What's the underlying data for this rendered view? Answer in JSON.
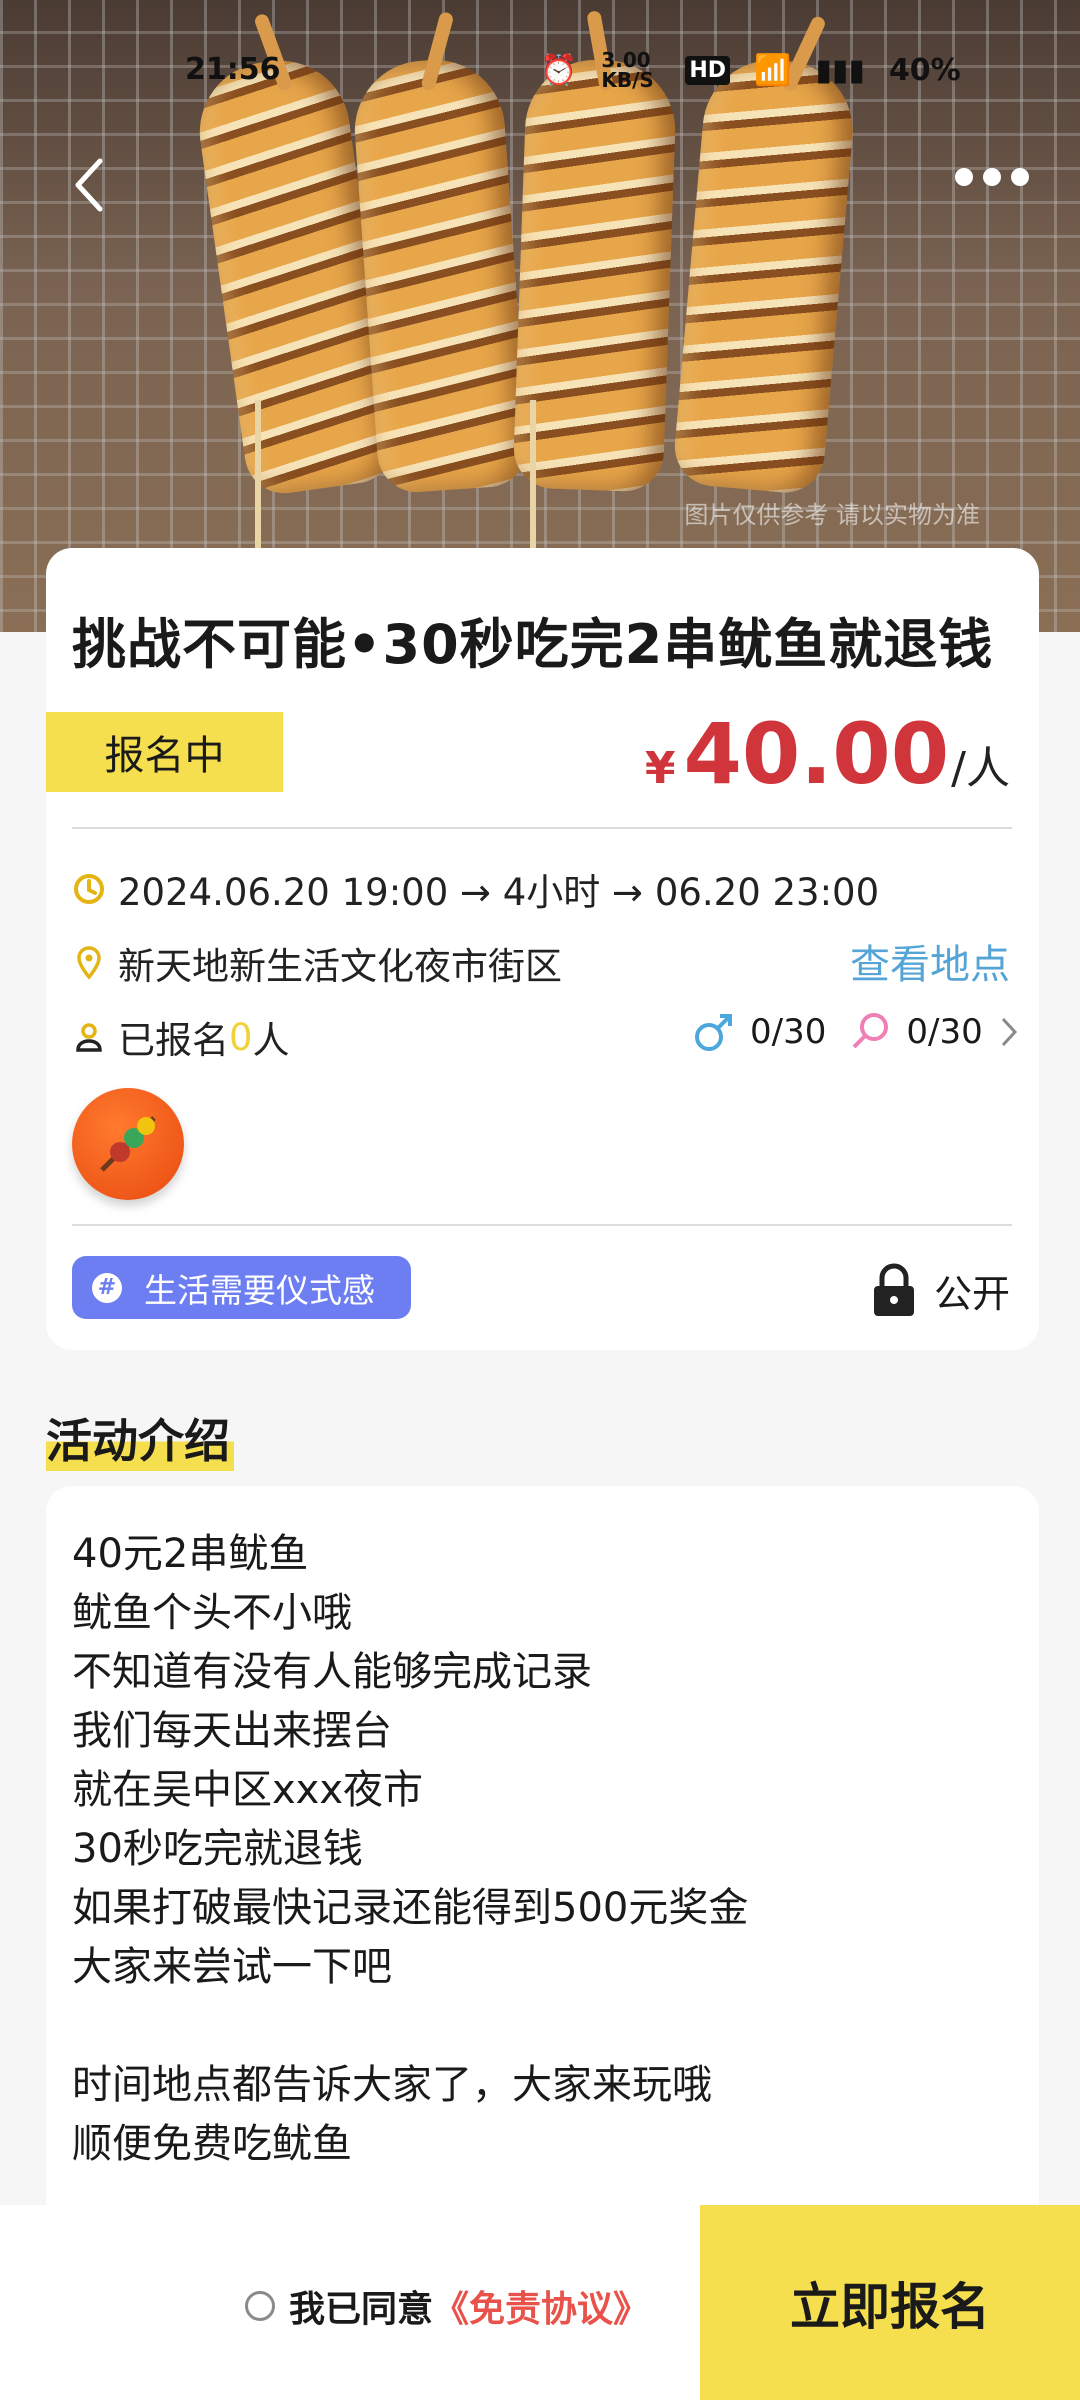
{
  "status_bar": {
    "time": "21:56",
    "speed": "3.00 KB/S",
    "battery": "40%"
  },
  "hero": {
    "watermark": "图片仅供参考 请以实物为准"
  },
  "event": {
    "title": "挑战不可能•30秒吃完2串鱿鱼就退钱",
    "status_badge": "报名中",
    "price_currency": "¥",
    "price": "40.00",
    "price_unit": "/人",
    "time_range": "2024.06.20 19:00 → 4小时 → 06.20 23:00",
    "location": "新天地新生活文化夜市街区",
    "view_location": "查看地点",
    "signed_prefix": "已报名",
    "signed_count": "0",
    "signed_suffix": "人",
    "male_count": "0/30",
    "female_count": "0/30",
    "tag": "生活需要仪式感",
    "privacy": "公开"
  },
  "intro": {
    "title": "活动介绍",
    "text": "40元2串鱿鱼\n鱿鱼个头不小哦\n不知道有没有人能够完成记录\n我们每天出来摆台\n就在吴中区xxx夜市\n30秒吃完就退钱\n如果打破最快记录还能得到500元奖金\n大家来尝试一下吧\n\n时间地点都告诉大家了，大家来玩哦\n顺便免费吃鱿鱼"
  },
  "footer": {
    "agree_text": "我已同意",
    "agreement": "《免责协议》",
    "signup_button": "立即报名"
  },
  "colors": {
    "accent_yellow": "#f6df4e",
    "price_red": "#d0353b",
    "link_blue": "#55a4d6",
    "tag_purple": "#6d7ef2"
  }
}
